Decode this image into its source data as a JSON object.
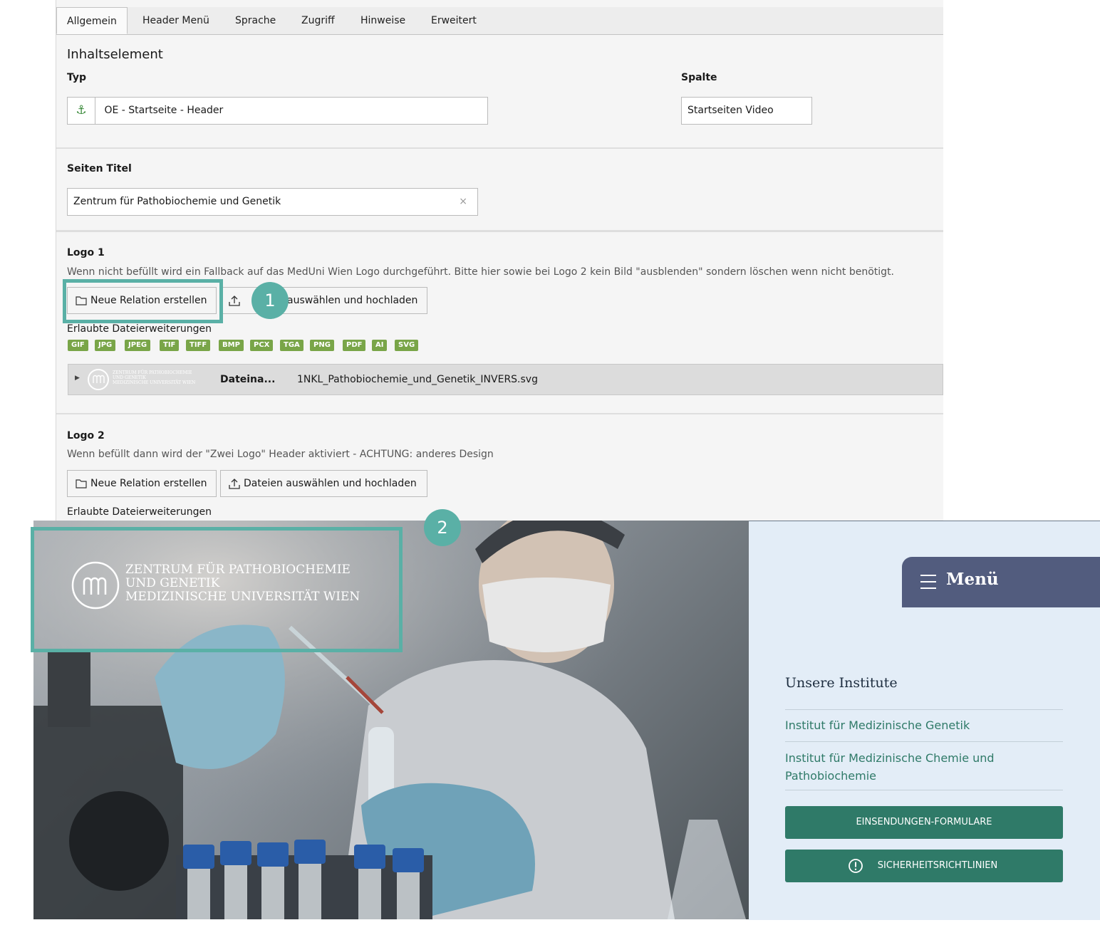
{
  "tabs": [
    "Allgemein",
    "Header Menü",
    "Sprache",
    "Zugriff",
    "Hinweise",
    "Erweitert"
  ],
  "section_title": "Inhaltselement",
  "typ": {
    "label": "Typ",
    "value": "OE - Startseite - Header"
  },
  "spalte": {
    "label": "Spalte",
    "value": "Startseiten Video"
  },
  "seiten_titel": {
    "label": "Seiten Titel",
    "value": "Zentrum für Pathobiochemie und Genetik",
    "clear": "×"
  },
  "logo1": {
    "label": "Logo 1",
    "description": "Wenn nicht befüllt wird ein Fallback auf das MedUni Wien Logo durchgeführt. Bitte hier sowie bei Logo 2 kein Bild \"ausblenden\" sondern löschen wenn nicht benötigt.",
    "btn_new": "Neue Relation erstellen",
    "btn_upload_visible": "auswählen und hochladen",
    "allowed_label": "Erlaubte Dateierweiterungen",
    "extensions": [
      "GIF",
      "JPG",
      "JPEG",
      "TIF",
      "TIFF",
      "BMP",
      "PCX",
      "TGA",
      "PNG",
      "PDF",
      "AI",
      "SVG"
    ],
    "file_label": "Dateina...",
    "file_name": "1NKL_Pathobiochemie_und_Genetik_INVERS.svg",
    "thumb_text": [
      "ZENTRUM FÜR PATHOBIOCHEMIE",
      "UND GENETIK",
      "MEDIZINISCHE UNIVERSITÄT WIEN"
    ]
  },
  "logo2": {
    "label": "Logo 2",
    "description": "Wenn befüllt dann wird der \"Zwei Logo\" Header aktiviert - ACHTUNG: anderes Design",
    "btn_new": "Neue Relation erstellen",
    "btn_upload": "Dateien auswählen und hochladen",
    "allowed_label": "Erlaubte Dateierweiterungen"
  },
  "badges": [
    "1",
    "2"
  ],
  "hero": {
    "logo_lines": [
      "ZENTRUM FÜR PATHOBIOCHEMIE",
      "UND GENETIK",
      "MEDIZINISCHE UNIVERSITÄT WIEN"
    ],
    "menu_label": "Menü",
    "institutes_title": "Unsere Institute",
    "institutes": [
      "Institut für Medizinische Genetik",
      "Institut für Medizinische Chemie und Pathobiochemie"
    ],
    "btn_forms": "EINSENDUNGEN-FORMULARE",
    "btn_security": "SICHERHEITSRICHTLINIEN"
  },
  "colors": {
    "highlight": "#5ab0a6",
    "extension": "#79a548",
    "teal_button": "#2f7a68",
    "menu_bg": "#525c7e",
    "panel_bg": "#e3edf7"
  }
}
